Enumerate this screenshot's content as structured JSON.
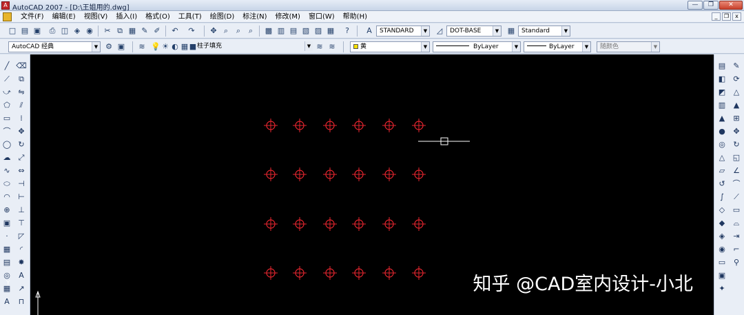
{
  "window": {
    "title": "AutoCAD 2007 - [D:\\王姐用的.dwg]",
    "app_icon": "A"
  },
  "window_controls": {
    "minimize": "—",
    "restore": "❐",
    "close": "✕"
  },
  "menu": {
    "items": [
      "文件(F)",
      "编辑(E)",
      "视图(V)",
      "插入(I)",
      "格式(O)",
      "工具(T)",
      "绘图(D)",
      "标注(N)",
      "修改(M)",
      "窗口(W)",
      "帮助(H)"
    ],
    "doc_controls": {
      "minimize": "_",
      "restore": "❐",
      "close": "x"
    }
  },
  "toolbar_top": {
    "text_style": "STANDARD",
    "dim_style": "DOT-BASE",
    "table_style": "Standard"
  },
  "toolbar_layers": {
    "workspace": "AutoCAD 经典",
    "layer": "柱子填充",
    "color": "黄",
    "linetype": "ByLayer",
    "lineweight": "ByLayer",
    "plotstyle": "随颜色"
  },
  "canvas": {
    "background": "#000000",
    "marker_color": "#e8262f",
    "crosshair_color": "#ffffff",
    "ucs_label": "Y",
    "watermark": "知乎 @CAD室内设计-小北"
  },
  "icons": {
    "left_col_a": [
      "line-icon",
      "construction-line-icon",
      "polyline-icon",
      "polygon-icon",
      "rectangle-icon",
      "arc-icon",
      "circle-icon",
      "revision-cloud-icon",
      "spline-icon",
      "ellipse-icon",
      "ellipse-arc-icon",
      "insert-block-icon",
      "make-block-icon",
      "point-icon",
      "hatch-icon",
      "gradient-icon",
      "region-icon",
      "table-icon",
      "mtext-icon"
    ],
    "right_col_a": [
      "layer-manager-icon",
      "box-icon",
      "wedge-icon",
      "cylinder-icon",
      "cone-icon",
      "sphere-icon",
      "torus-icon",
      "pyramid-icon",
      "extrude-icon",
      "revolve-icon",
      "sweep-icon",
      "loft-icon",
      "union-icon",
      "subtract-icon",
      "intersect-icon",
      "section-icon",
      "render-icon",
      "light-icon"
    ]
  }
}
